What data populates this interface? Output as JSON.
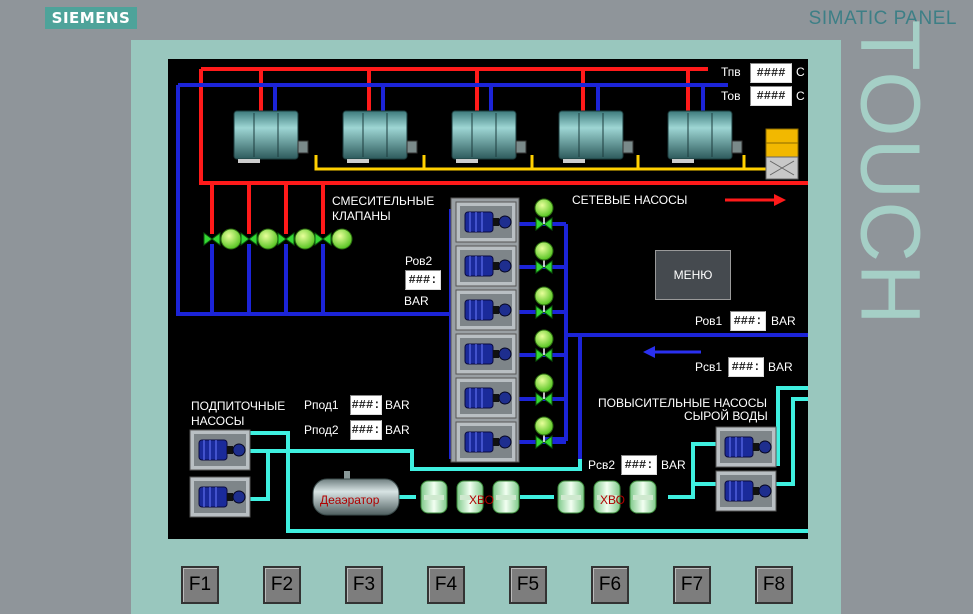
{
  "brand": "SIEMENS",
  "panel_name": "SIMATIC PANEL",
  "bezel_word": "TOUCH",
  "screen": {
    "tpv_label": "Тпв",
    "tpv_value": "####",
    "tpv_unit": "С",
    "tov_label": "Тов",
    "tov_value": "####",
    "tov_unit": "С",
    "mixing_valves_label_1": "СМЕСИТЕЛЬНЫЕ",
    "mixing_valves_label_2": "КЛАПАНЫ",
    "network_pumps_label": "СЕТЕВЫЕ НАСОСЫ",
    "rov2_label": "Ров2",
    "rov2_value": "###:",
    "rov2_unit": "BAR",
    "menu_button": "МЕНЮ",
    "rov1_label": "Ров1",
    "rov1_value": "###:",
    "rov1_unit": "BAR",
    "rsv1_label": "Рсв1",
    "rsv1_value": "###:",
    "rsv1_unit": "BAR",
    "makeup_pumps_label_1": "ПОДПИТОЧНЫЕ",
    "makeup_pumps_label_2": "НАСОСЫ",
    "rpod1_label": "Рпод1",
    "rpod1_value": "###:",
    "rpod1_unit": "BAR",
    "rpod2_label": "Рпод2",
    "rpod2_value": "###:",
    "rpod2_unit": "BAR",
    "booster_pumps_label_1": "ПОВЫСИТЕЛЬНЫЕ НАСОСЫ",
    "booster_pumps_label_2": "СЫРОЙ ВОДЫ",
    "rsv2_label": "Рсв2",
    "rsv2_value": "###:",
    "rsv2_unit": "BAR",
    "deaerator_label": "Деаэратор",
    "hvo1_label": "ХВО",
    "hvo2_label": "ХВО"
  },
  "function_keys": [
    "F1",
    "F2",
    "F3",
    "F4",
    "F5",
    "F6",
    "F7",
    "F8"
  ],
  "colors": {
    "hot_pipe": "#ff1a1a",
    "return_pipe": "#1c24d8",
    "makeup_pipe": "#3ff0e0",
    "fuel_line": "#ffd000",
    "valve": "#35d835",
    "bezel": "#99c7be"
  }
}
